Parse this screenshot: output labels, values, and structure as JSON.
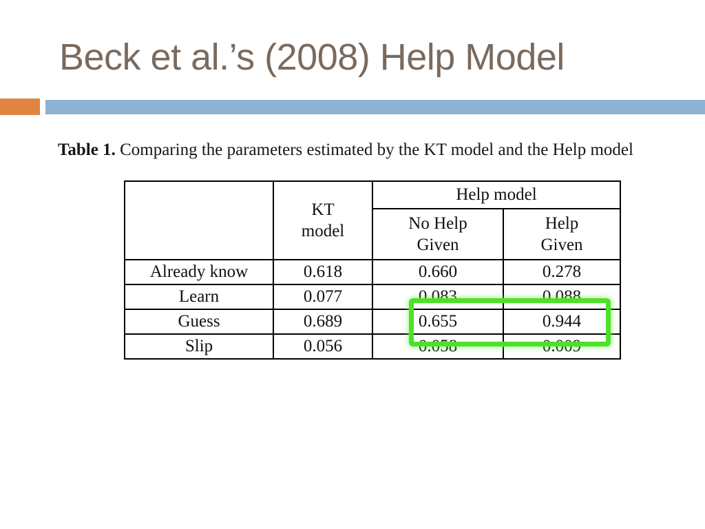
{
  "slide": {
    "title": "Beck et al.’s (2008) Help Model",
    "title_color": "#7a6a5e",
    "background_color": "#ffffff"
  },
  "divider": {
    "accent_color": "#e0853f",
    "bar_color": "#8eb2d3"
  },
  "table_caption": {
    "label": "Table 1.",
    "text": " Comparing the parameters estimated by the KT model and the Help model"
  },
  "table": {
    "header": {
      "corner": "",
      "kt_model": "KT\nmodel",
      "kt_model_line1": "KT",
      "kt_model_line2": "model",
      "help_model": "Help model",
      "sub_no_help_line1": "No Help",
      "sub_no_help_line2": "Given",
      "sub_help_line1": "Help",
      "sub_help_line2": "Given"
    },
    "columns": [
      "",
      "KT model",
      "No Help Given",
      "Help Given"
    ],
    "rows": [
      {
        "label": "Already know",
        "kt_model": "0.618",
        "no_help_given": "0.660",
        "help_given": "0.278"
      },
      {
        "label": "Learn",
        "kt_model": "0.077",
        "no_help_given": "0.083",
        "help_given": "0.088"
      },
      {
        "label": "Guess",
        "kt_model": "0.689",
        "no_help_given": "0.655",
        "help_given": "0.944"
      },
      {
        "label": "Slip",
        "kt_model": "0.056",
        "no_help_given": "0.058",
        "help_given": "0.009"
      }
    ]
  },
  "annotation": {
    "highlight_color": "#4fe02c",
    "highlight_covers": [
      "Guess / No Help Given",
      "Guess / Help Given",
      "Slip / No Help Given",
      "Slip / Help Given"
    ]
  }
}
